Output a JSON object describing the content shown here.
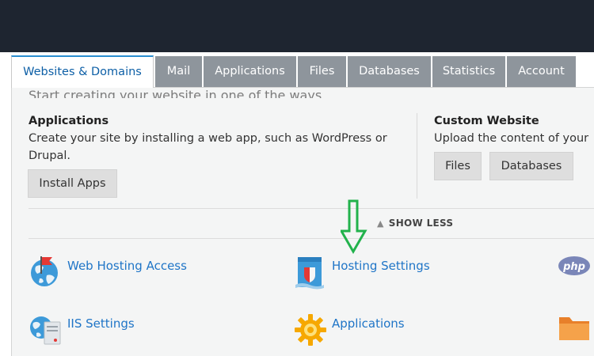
{
  "tabs": [
    {
      "label": "Websites & Domains",
      "active": true
    },
    {
      "label": "Mail"
    },
    {
      "label": "Applications"
    },
    {
      "label": "Files"
    },
    {
      "label": "Databases"
    },
    {
      "label": "Statistics"
    },
    {
      "label": "Account"
    }
  ],
  "intro": {
    "text": "Start creating your website in one of the ways"
  },
  "applications_card": {
    "title": "Applications",
    "description": "Create your site by installing a web app, such as WordPress or Drupal.",
    "button_label": "Install Apps"
  },
  "custom_card": {
    "title": "Custom Website",
    "description": "Upload the content of your",
    "files_button": "Files",
    "databases_button": "Databases"
  },
  "show_less_label": "SHOW LESS",
  "tools": [
    {
      "label": "Web Hosting Access",
      "icon": "globe-flag-icon"
    },
    {
      "label": "Hosting Settings",
      "icon": "hosting-settings-icon"
    },
    {
      "label": "",
      "icon": "php-icon"
    },
    {
      "label": "IIS Settings",
      "icon": "iis-globe-icon"
    },
    {
      "label": "Applications",
      "icon": "gear-icon"
    },
    {
      "label": "",
      "icon": "folder-icon"
    }
  ],
  "colors": {
    "topbar": "#1e2530",
    "tab_inactive": "#8e959c",
    "link": "#1f75c7",
    "annotation_arrow": "#22b24c"
  }
}
